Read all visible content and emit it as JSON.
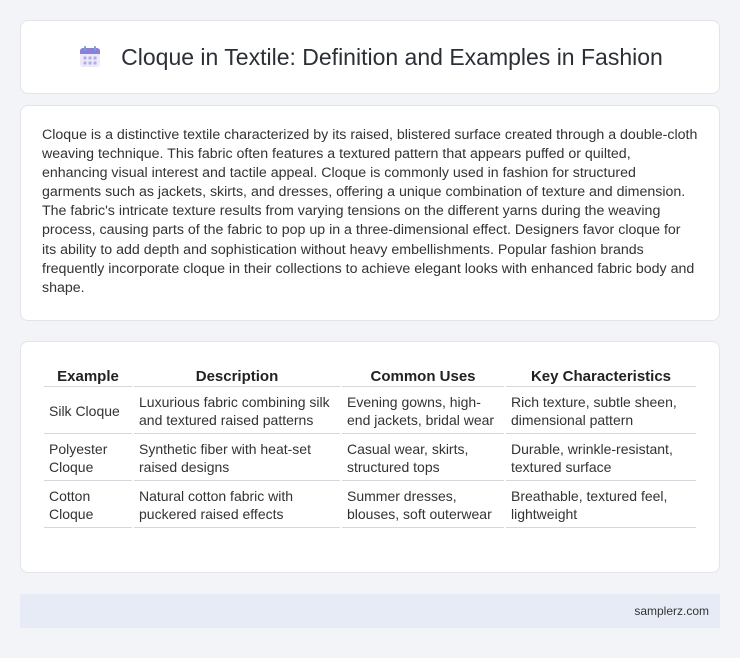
{
  "header": {
    "icon": "calendar-icon",
    "title": "Cloque in Textile: Definition and Examples in Fashion"
  },
  "intro": {
    "text": "Cloque is a distinctive textile characterized by its raised, blistered surface created through a double-cloth weaving technique. This fabric often features a textured pattern that appears puffed or quilted, enhancing visual interest and tactile appeal. Cloque is commonly used in fashion for structured garments such as jackets, skirts, and dresses, offering a unique combination of texture and dimension. The fabric's intricate texture results from varying tensions on the different yarns during the weaving process, causing parts of the fabric to pop up in a three-dimensional effect. Designers favor cloque for its ability to add depth and sophistication without heavy embellishments. Popular fashion brands frequently incorporate cloque in their collections to achieve elegant looks with enhanced fabric body and shape."
  },
  "table": {
    "headers": [
      "Example",
      "Description",
      "Common Uses",
      "Key Characteristics"
    ],
    "rows": [
      [
        "Silk Cloque",
        "Luxurious fabric combining silk and textured raised patterns",
        "Evening gowns, high-end jackets, bridal wear",
        "Rich texture, subtle sheen, dimensional pattern"
      ],
      [
        "Polyester Cloque",
        "Synthetic fiber with heat-set raised designs",
        "Casual wear, skirts, structured tops",
        "Durable, wrinkle-resistant, textured surface"
      ],
      [
        "Cotton Cloque",
        "Natural cotton fabric with puckered raised effects",
        "Summer dresses, blouses, soft outerwear",
        "Breathable, textured feel, lightweight"
      ]
    ]
  },
  "footer": {
    "link": "samplerz.com"
  },
  "colors": {
    "background": "#f3f4f8",
    "footer_bar": "#e6ebf6",
    "icon_purple": "#8b7fd8",
    "icon_blue": "#6fa2e0"
  }
}
